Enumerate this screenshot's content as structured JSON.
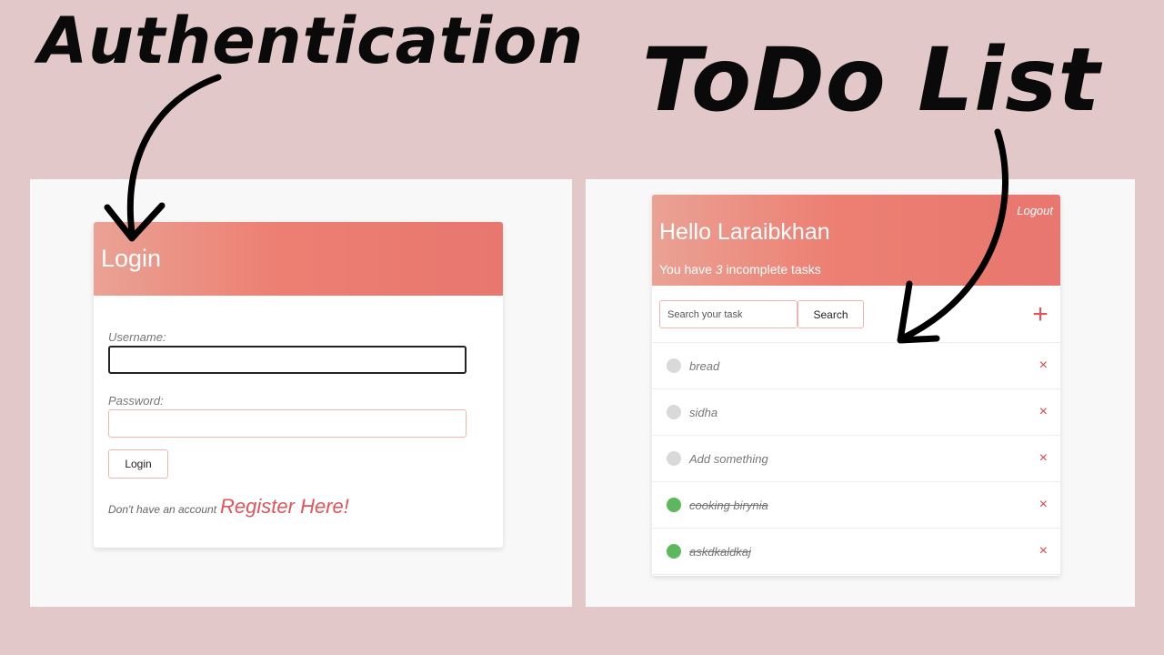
{
  "headings": {
    "auth": "Authentication",
    "todo": "ToDo List"
  },
  "login": {
    "title": "Login",
    "username_label": "Username:",
    "username_value": "",
    "password_label": "Password:",
    "password_value": "",
    "button_label": "Login",
    "register_prompt": "Don't have an account",
    "register_link": "Register Here!"
  },
  "todo": {
    "logout": "Logout",
    "greeting": "Hello Laraibkhan",
    "incomplete_prefix": "You have",
    "incomplete_count": "3",
    "incomplete_suffix": "incomplete tasks",
    "search_placeholder": "Search your task",
    "search_button": "Search",
    "add_glyph": "+",
    "delete_glyph": "×",
    "tasks": [
      {
        "text": "bread",
        "done": false
      },
      {
        "text": "sidha",
        "done": false
      },
      {
        "text": "Add something",
        "done": false
      },
      {
        "text": "cooking birynia",
        "done": true
      },
      {
        "text": "askdkaldkaj",
        "done": true
      }
    ]
  },
  "colors": {
    "background": "#e2c8c8",
    "accent": "#e0555a",
    "header_gradient_start": "#eaa294",
    "header_gradient_end": "#e8776f",
    "done_dot": "#5cb85c",
    "pending_dot": "#d9d9d9"
  },
  "icons": {
    "arrows": "curved-arrow-icon",
    "add": "plus-icon",
    "delete": "close-icon",
    "status": "status-dot-icon"
  }
}
